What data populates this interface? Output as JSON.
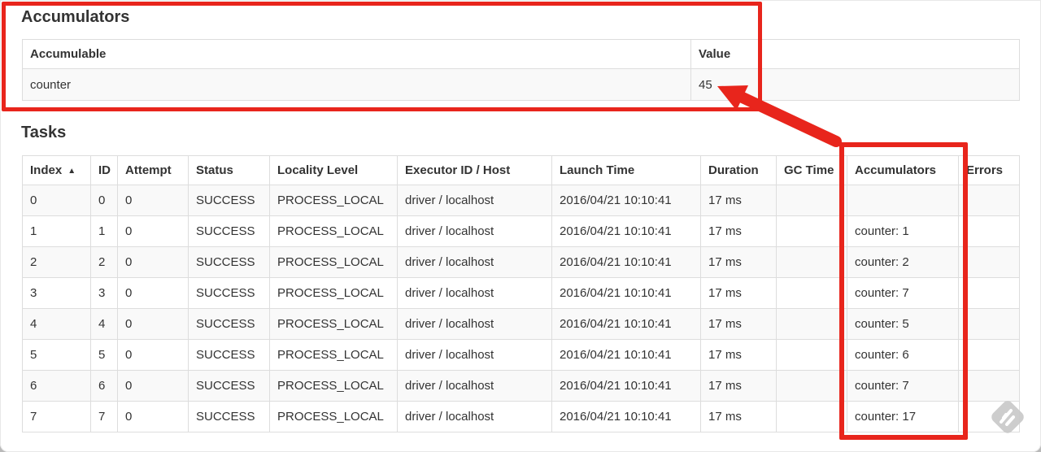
{
  "annotation_color": "#e8251c",
  "watermark_color": "#c9c9c9",
  "accumulators_section": {
    "title": "Accumulators",
    "table": {
      "headers": [
        "Accumulable",
        "Value"
      ],
      "rows": [
        [
          "counter",
          "45"
        ]
      ]
    }
  },
  "tasks_section": {
    "title": "Tasks",
    "table": {
      "headers": [
        "Index",
        "ID",
        "Attempt",
        "Status",
        "Locality Level",
        "Executor ID / Host",
        "Launch Time",
        "Duration",
        "GC Time",
        "Accumulators",
        "Errors"
      ],
      "sort_icon": "▲",
      "rows": [
        [
          "0",
          "0",
          "0",
          "SUCCESS",
          "PROCESS_LOCAL",
          "driver / localhost",
          "2016/04/21 10:10:41",
          "17 ms",
          "",
          "",
          ""
        ],
        [
          "1",
          "1",
          "0",
          "SUCCESS",
          "PROCESS_LOCAL",
          "driver / localhost",
          "2016/04/21 10:10:41",
          "17 ms",
          "",
          "counter: 1",
          ""
        ],
        [
          "2",
          "2",
          "0",
          "SUCCESS",
          "PROCESS_LOCAL",
          "driver / localhost",
          "2016/04/21 10:10:41",
          "17 ms",
          "",
          "counter: 2",
          ""
        ],
        [
          "3",
          "3",
          "0",
          "SUCCESS",
          "PROCESS_LOCAL",
          "driver / localhost",
          "2016/04/21 10:10:41",
          "17 ms",
          "",
          "counter: 7",
          ""
        ],
        [
          "4",
          "4",
          "0",
          "SUCCESS",
          "PROCESS_LOCAL",
          "driver / localhost",
          "2016/04/21 10:10:41",
          "17 ms",
          "",
          "counter: 5",
          ""
        ],
        [
          "5",
          "5",
          "0",
          "SUCCESS",
          "PROCESS_LOCAL",
          "driver / localhost",
          "2016/04/21 10:10:41",
          "17 ms",
          "",
          "counter: 6",
          ""
        ],
        [
          "6",
          "6",
          "0",
          "SUCCESS",
          "PROCESS_LOCAL",
          "driver / localhost",
          "2016/04/21 10:10:41",
          "17 ms",
          "",
          "counter: 7",
          ""
        ],
        [
          "7",
          "7",
          "0",
          "SUCCESS",
          "PROCESS_LOCAL",
          "driver / localhost",
          "2016/04/21 10:10:41",
          "17 ms",
          "",
          "counter: 17",
          ""
        ]
      ]
    }
  }
}
